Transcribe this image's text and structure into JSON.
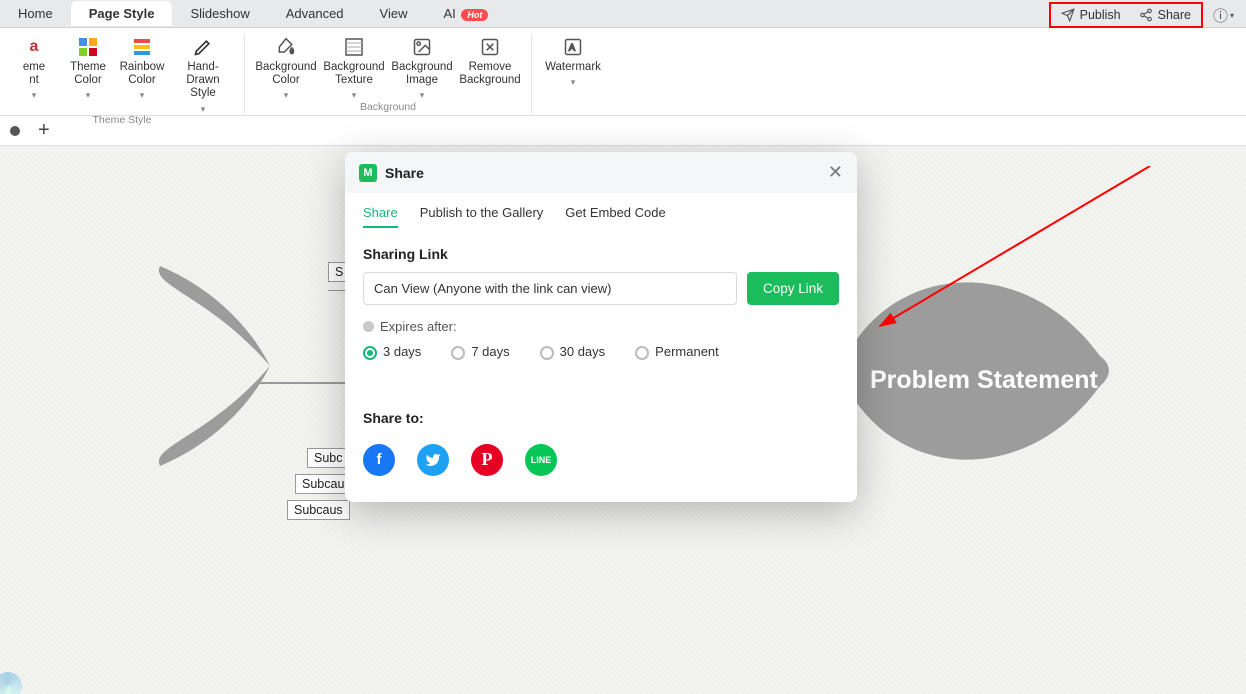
{
  "menuTabs": {
    "home": "Home",
    "pageStyle": "Page Style",
    "slideshow": "Slideshow",
    "advanced": "Advanced",
    "view": "View",
    "ai": "AI",
    "hot": "Hot"
  },
  "topRight": {
    "publish": "Publish",
    "share": "Share"
  },
  "ribbon": {
    "themeFont": "eme\nnt",
    "themeColor": "Theme\nColor",
    "rainbowColor": "Rainbow\nColor",
    "handDrawn": "Hand-Drawn\nStyle",
    "themeStyleGroup": "Theme Style",
    "bgColor": "Background\nColor",
    "bgTexture": "Background\nTexture",
    "bgImage": "Background\nImage",
    "removeBg": "Remove\nBackground",
    "watermark": "Watermark",
    "bgGroup": "Background"
  },
  "canvas": {
    "problem": "Problem Statement",
    "s1": "S",
    "sub1": "Subc",
    "sub2": "Subcau",
    "sub3": "Subcaus"
  },
  "modal": {
    "title": "Share",
    "tabs": {
      "share": "Share",
      "gallery": "Publish to the Gallery",
      "embed": "Get Embed Code"
    },
    "sharingLink": "Sharing Link",
    "linkText": "Can View (Anyone with the link can view)",
    "copy": "Copy Link",
    "expires": "Expires after:",
    "opt3": "3 days",
    "opt7": "7 days",
    "opt30": "30 days",
    "optPerm": "Permanent",
    "shareTo": "Share to:",
    "line": "LINE"
  }
}
